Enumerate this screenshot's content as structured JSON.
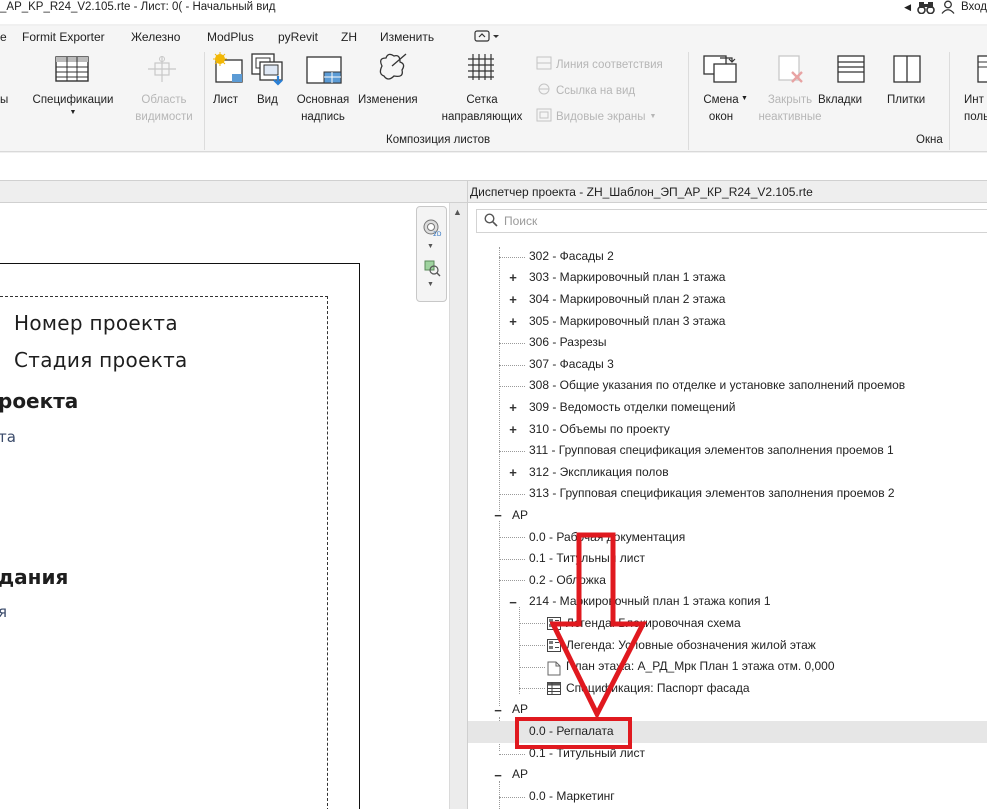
{
  "window": {
    "title": "_AP_KP_R24_V2.105.rte - Лист: 0( - Начальный вид",
    "signin": "Вход"
  },
  "menu": [
    "е",
    "Formit Exporter",
    "Железно",
    "ModPlus",
    "pyRevit",
    "ZH",
    "Изменить"
  ],
  "ribbon": {
    "buttons": {
      "ry": "ы",
      "specs": "Спецификации",
      "vis1": "Область",
      "vis2": "видимости",
      "sheet": "Лист",
      "view": "Вид",
      "titleblock1": "Основная",
      "titleblock2": "надпись",
      "revisions": "Изменения",
      "grid1": "Сетка",
      "grid2": "направляющих",
      "matchline": "Линия соответствия",
      "viewref": "Ссылка на вид",
      "viewports": "Видовые экраны",
      "switch1": "Смена",
      "switch2": "окон",
      "close1": "Закрыть",
      "close2": "неактивные",
      "tabs": "Вкладки",
      "tile": "Плитки",
      "ui1": "Инт",
      "ui2": "поль"
    },
    "groups": {
      "sheet_composition": "Композиция листов",
      "windows": "Окна"
    }
  },
  "drawing": {
    "line1": "Номер проекта",
    "line2": "Стадия проекта",
    "frag1": "роекта",
    "frag2": "та",
    "frag3": "дания",
    "frag4": "я"
  },
  "browser": {
    "title": "Диспетчер проекта - ZH_Шаблон_ЭП_АР_КР_R24_V2.105.rte",
    "search_placeholder": "Поиск",
    "rows": [
      {
        "text": "302 - Фасады 2"
      },
      {
        "text": "303 - Маркировочный план 1 этажа"
      },
      {
        "text": "304 - Маркировочный план 2 этажа"
      },
      {
        "text": "305 - Маркировочный план 3 этажа"
      },
      {
        "text": "306 - Разрезы"
      },
      {
        "text": "307 - Фасады 3"
      },
      {
        "text": "308 - Общие указания по отделке и установке заполнений проемов"
      },
      {
        "text": "309 - Ведомость отделки помещений"
      },
      {
        "text": "310 - Объемы по проекту"
      },
      {
        "text": "311 - Групповая спецификация элементов заполнения проемов 1"
      },
      {
        "text": "312 - Экспликация полов"
      },
      {
        "text": "313 - Групповая спецификация элементов заполнения проемов 2"
      },
      {
        "text": "АР"
      },
      {
        "text": "0.0 - Рабочая документация"
      },
      {
        "text": "0.1 - Титульный лист"
      },
      {
        "text": "0.2 - Обложка"
      },
      {
        "text": "214 - Маркировочный план 1 этажа копия 1"
      },
      {
        "text": "Легенда: Блокировочная схема"
      },
      {
        "text": "Легенда: Условные обозначения жилой этаж"
      },
      {
        "text": "План этажа: А_РД_Мрк План 1 этажа отм. 0,000"
      },
      {
        "text": "Спецификация: Паспорт фасада"
      },
      {
        "text": "АР"
      },
      {
        "text": "0.0 - Регпалата"
      },
      {
        "text": "0.1 - Титульный лист"
      },
      {
        "text": "АР"
      },
      {
        "text": "0.0 - Маркетинг"
      }
    ]
  },
  "colors": {
    "annotation": "#e0191f",
    "selection": "#e6e6e6"
  }
}
